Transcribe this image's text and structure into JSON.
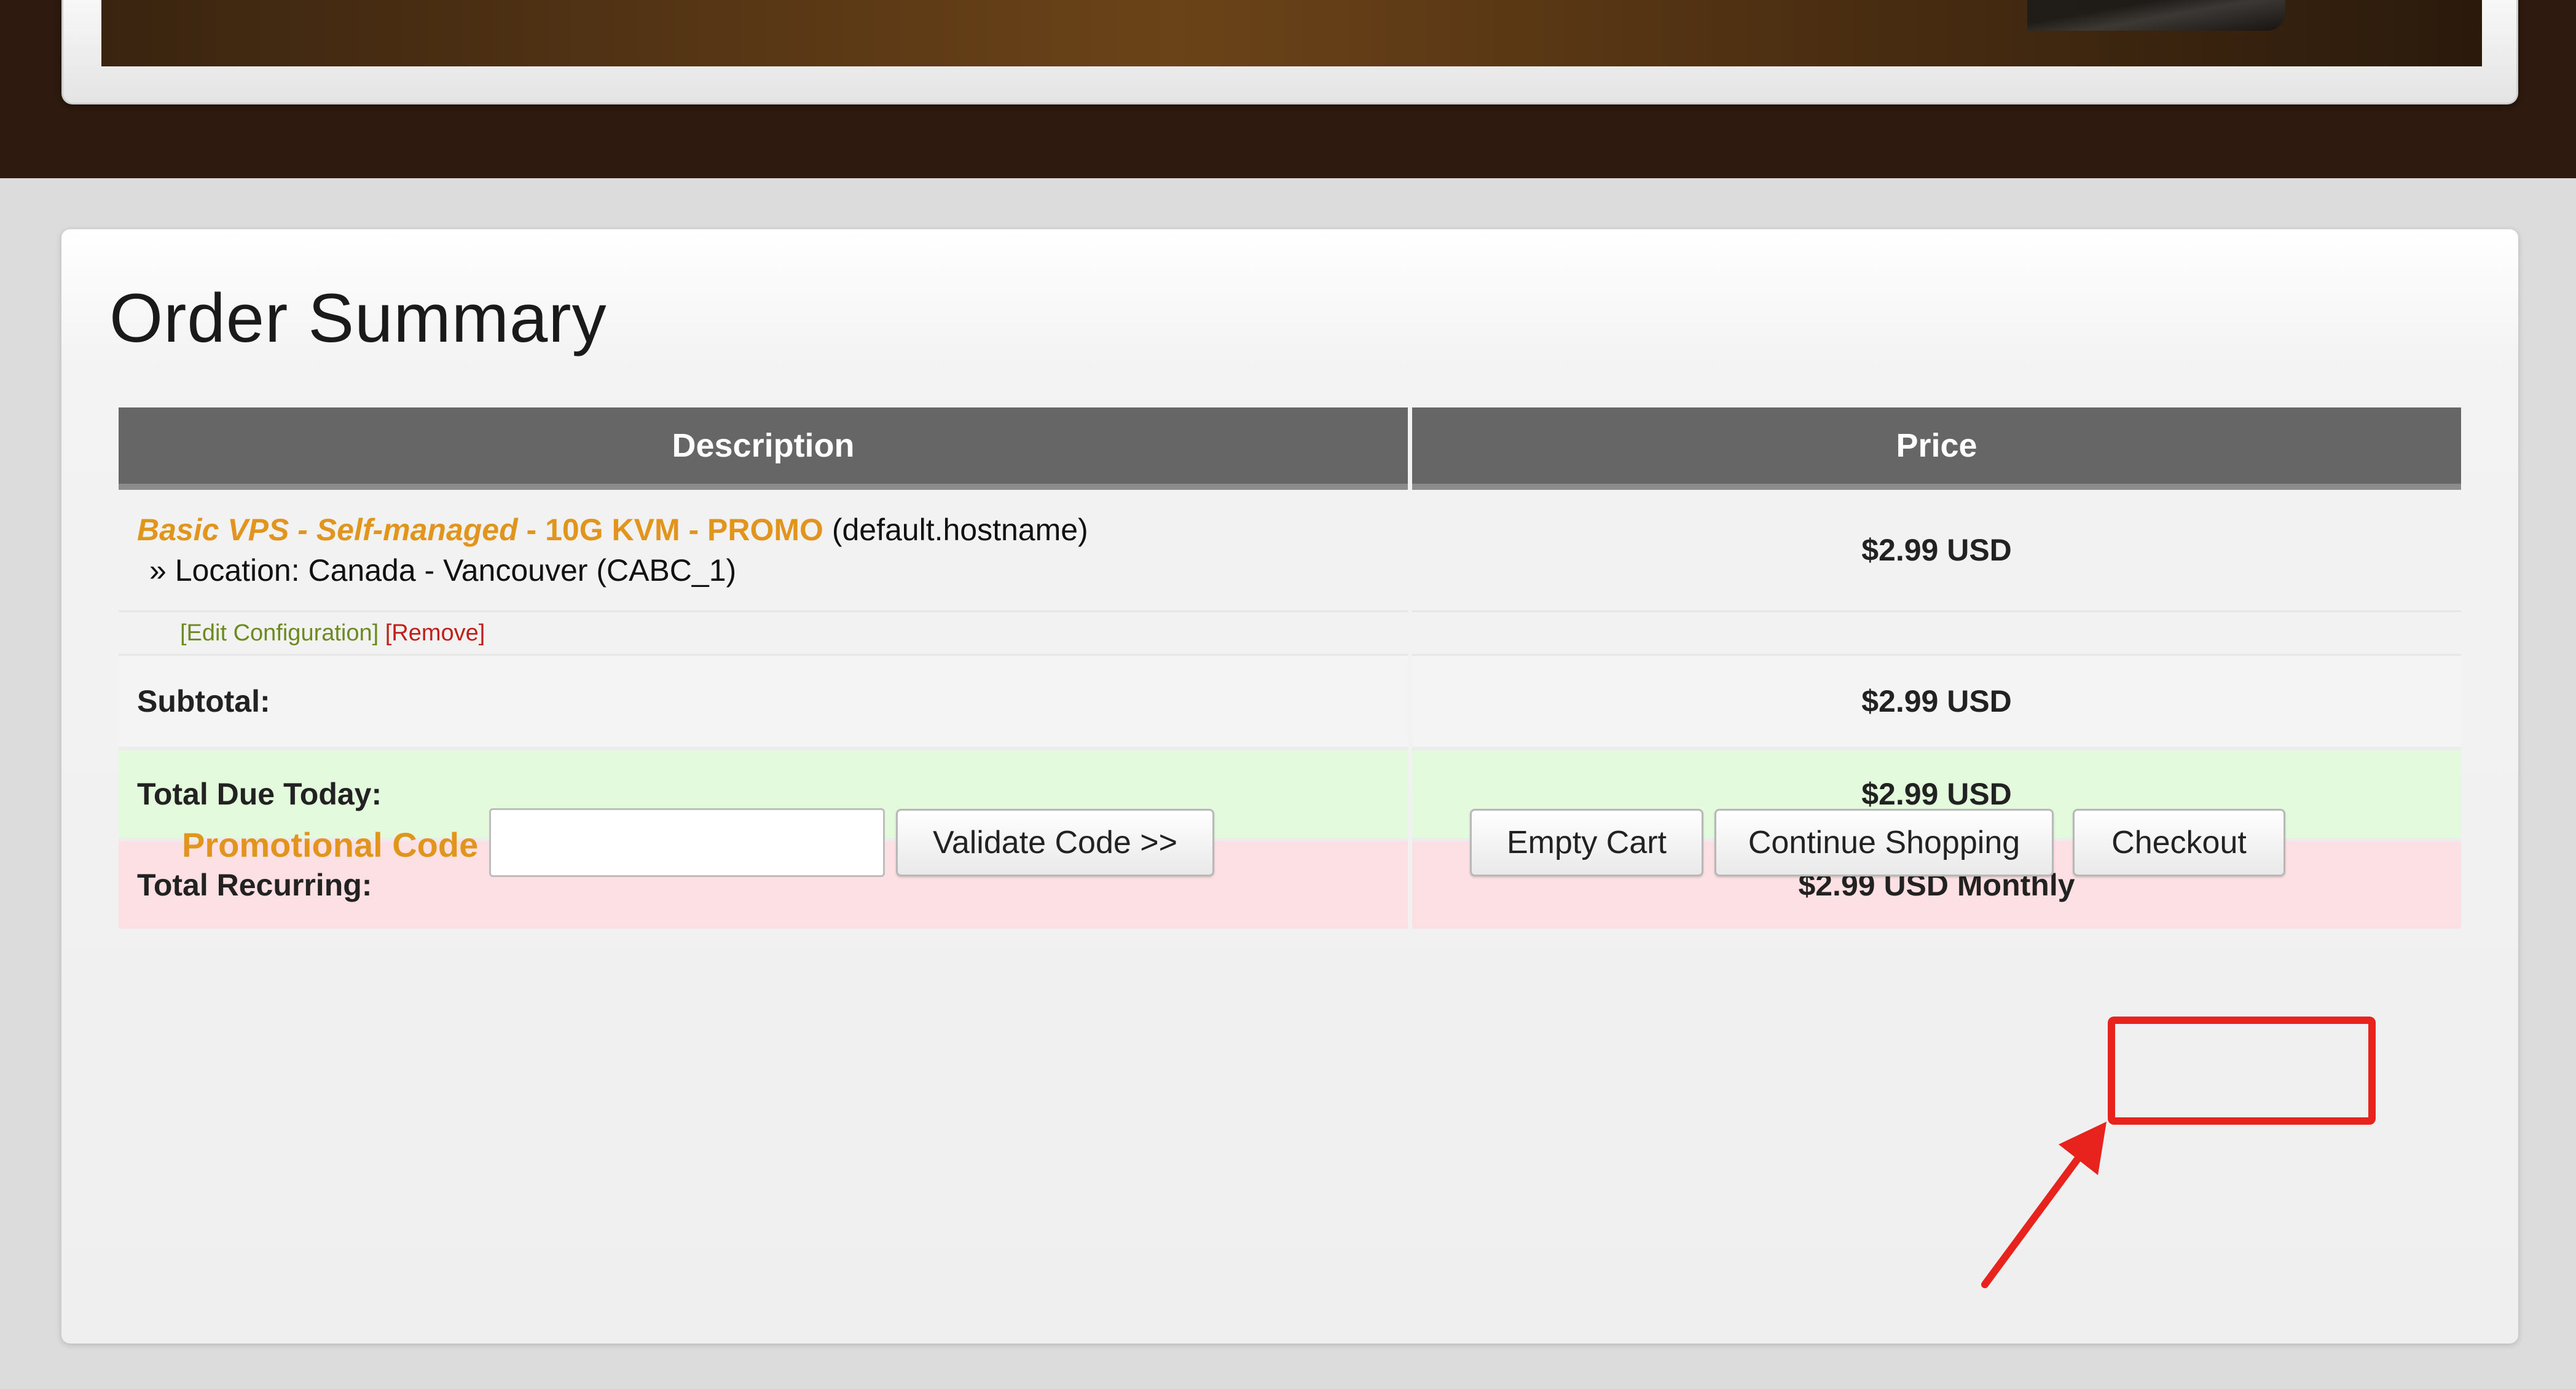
{
  "order": {
    "title": "Order Summary",
    "columns": {
      "description": "Description",
      "price": "Price"
    },
    "item": {
      "name_italic": "Basic VPS - Self-managed",
      "name_rest": " - 10G KVM - PROMO",
      "hostname": " (default.hostname)",
      "location": "» Location: Canada - Vancouver (CABC_1)",
      "price": "$2.99 USD",
      "edit_label": "[Edit Configuration]",
      "remove_label": "[Remove]"
    },
    "subtotal": {
      "label": "Subtotal:",
      "value": "$2.99 USD"
    },
    "total_due": {
      "label": "Total Due Today:",
      "value": "$2.99 USD"
    },
    "total_recurring": {
      "label": "Total Recurring:",
      "value": "$2.99 USD Monthly"
    }
  },
  "promo": {
    "label": "Promotional Code",
    "value": "",
    "validate_label": "Validate Code >>"
  },
  "buttons": {
    "empty_cart": "Empty Cart",
    "continue_shopping": "Continue Shopping",
    "checkout": "Checkout"
  },
  "colors": {
    "accent_orange": "#e1951c",
    "highlight_red": "#e8231e",
    "header_gray": "#666666",
    "due_green": "#e4fadc",
    "recurring_pink": "#fde0e3"
  }
}
